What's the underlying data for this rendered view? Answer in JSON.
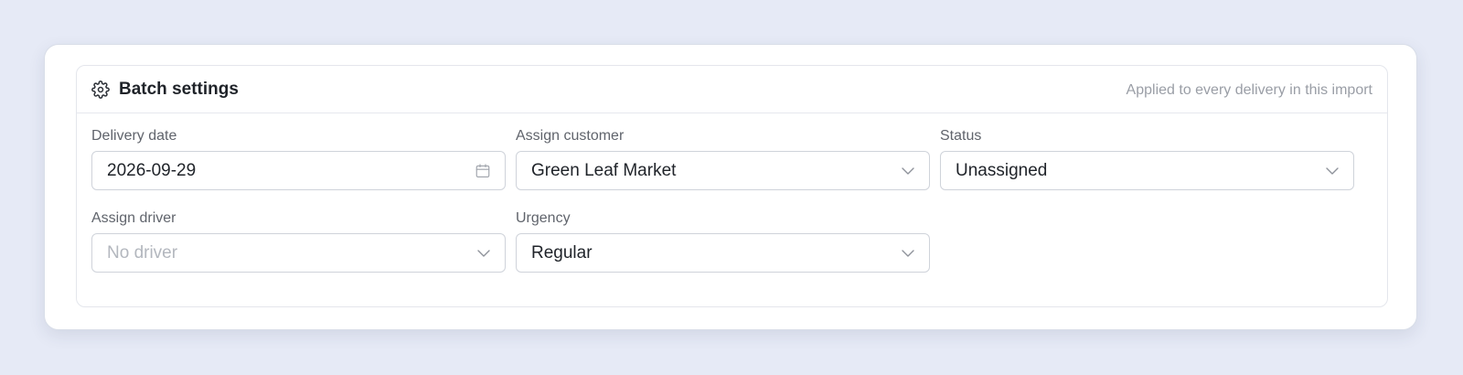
{
  "panel": {
    "title": "Batch settings",
    "hint": "Applied to every delivery in this import",
    "icon": "gear-icon"
  },
  "fields": {
    "delivery_date": {
      "label": "Delivery date",
      "value": "2026-09-29",
      "icon": "calendar-icon"
    },
    "customer": {
      "label": "Assign customer",
      "value": "Green Leaf Market",
      "icon": "chevron-down-icon"
    },
    "status": {
      "label": "Status",
      "value": "Unassigned",
      "icon": "chevron-down-icon"
    },
    "driver": {
      "label": "Assign driver",
      "placeholder": "No driver",
      "value": "",
      "icon": "chevron-down-icon"
    },
    "urgency": {
      "label": "Urgency",
      "value": "Regular",
      "icon": "chevron-down-icon"
    }
  },
  "colors": {
    "page_background": "#e6eaf6",
    "card_background": "#ffffff",
    "text_primary": "#1f2329",
    "text_secondary": "#60646c",
    "text_muted": "#9a9ea6",
    "placeholder": "#b3b7be",
    "border": "#cfd3da"
  }
}
